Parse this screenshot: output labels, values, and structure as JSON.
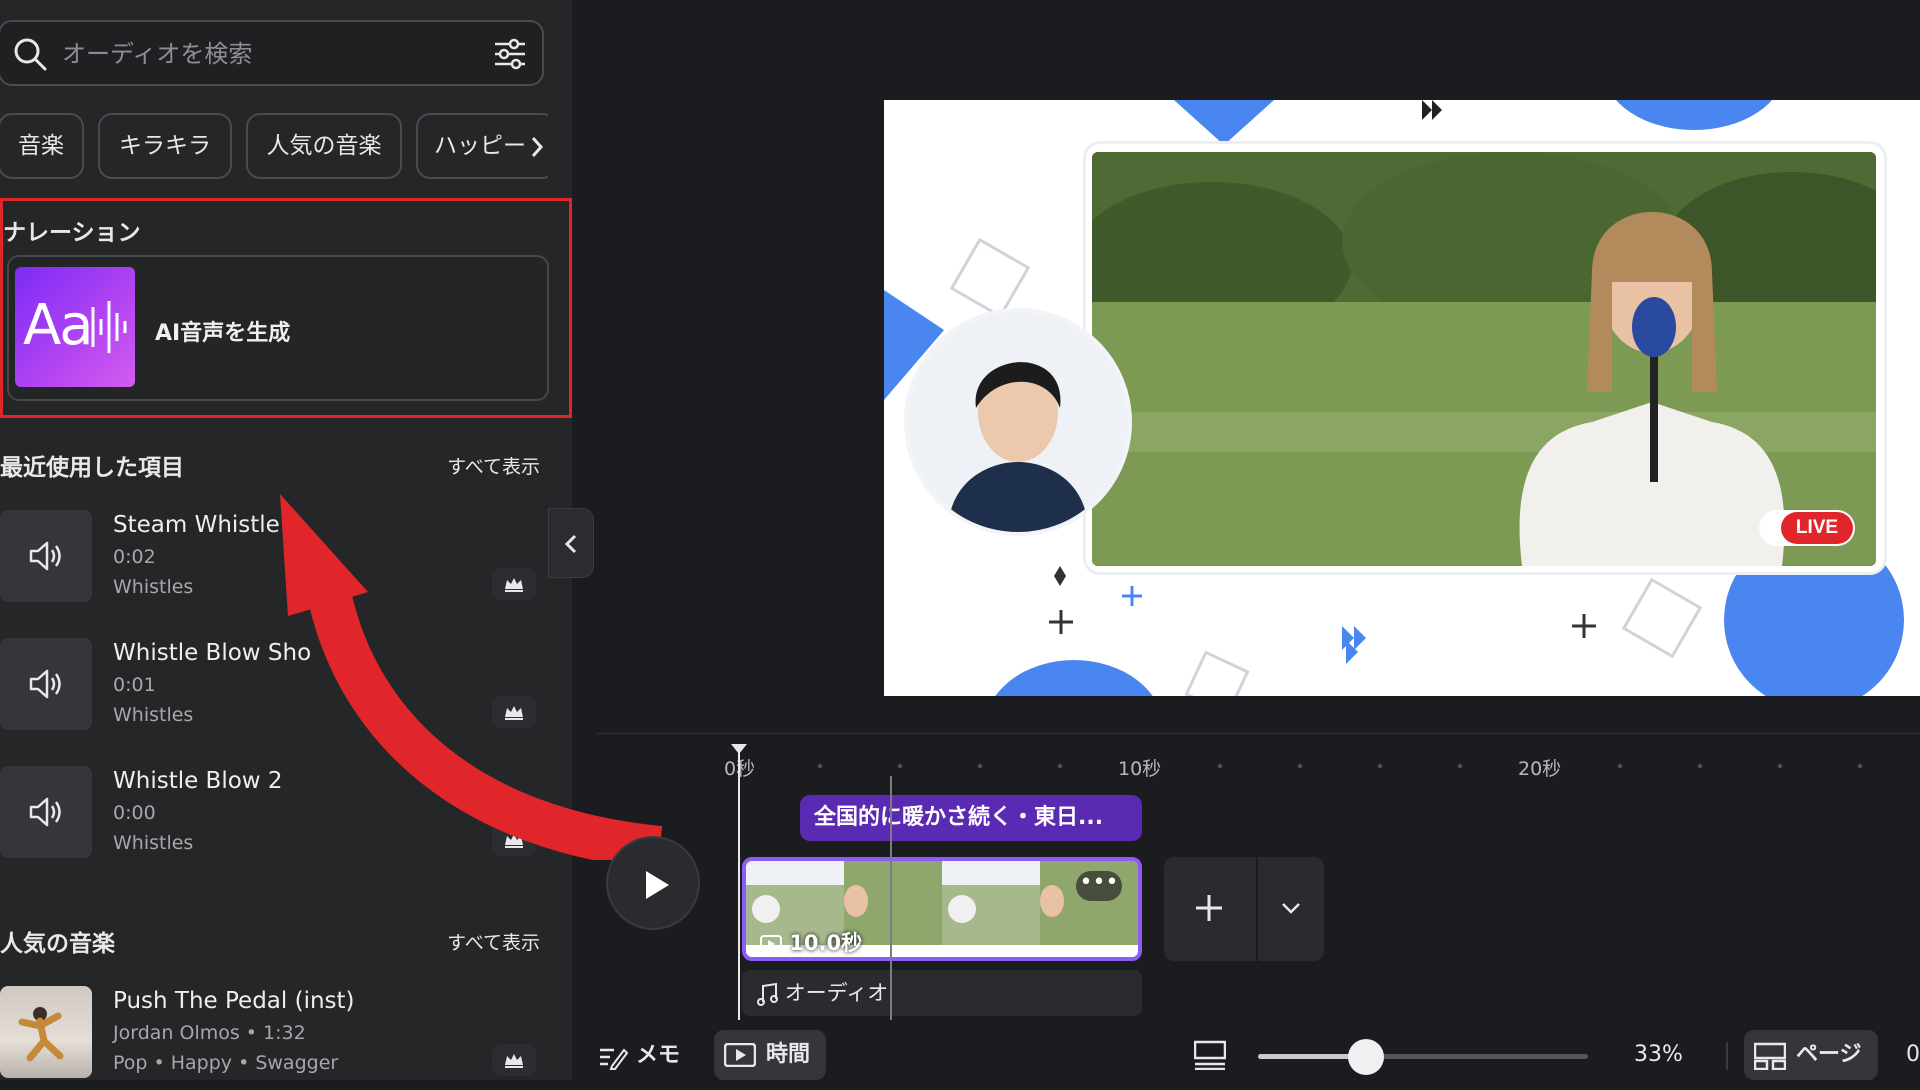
{
  "search": {
    "placeholder": "オーディオを検索"
  },
  "chips": [
    "音楽",
    "キラキラ",
    "人気の音楽",
    "ハッピー"
  ],
  "narration": {
    "title": "ナレーション",
    "ai_thumb_text": "Aa",
    "ai_label": "AI音声を生成"
  },
  "recent": {
    "title": "最近使用した項目",
    "see_all": "すべて表示",
    "items": [
      {
        "name": "Steam Whistle",
        "duration": "0:02",
        "artist": "Whistles"
      },
      {
        "name": "Whistle Blow Sho",
        "duration": "0:01",
        "artist": "Whistles"
      },
      {
        "name": "Whistle Blow 2",
        "duration": "0:00",
        "artist": "Whistles"
      }
    ]
  },
  "popular": {
    "title": "人気の音楽",
    "see_all": "すべて表示",
    "items": [
      {
        "name": "Push The Pedal (inst)",
        "meta": "Jordan Olmos • 1:32",
        "tags": "Pop • Happy • Swagger"
      }
    ]
  },
  "canvas": {
    "live_badge": "LIVE"
  },
  "timeline": {
    "ruler_labels": [
      "0秒",
      "10秒",
      "20秒"
    ],
    "caption_clip": "全国的に暖かさ続く・東日...",
    "video_clip_duration": "10.0秒",
    "more_label": "•••",
    "audio_track": "オーディオ"
  },
  "bottom_bar": {
    "notes": "メモ",
    "time": "時間",
    "zoom": "33%",
    "zoom_fraction": 0.33,
    "pages": "ページ",
    "page_count": "0"
  },
  "colors": {
    "accent_purple": "#8b5cf6",
    "caption_purple": "#5b2ab3",
    "highlight_red": "#e0262b",
    "canvas_blue": "#4a86ef"
  }
}
